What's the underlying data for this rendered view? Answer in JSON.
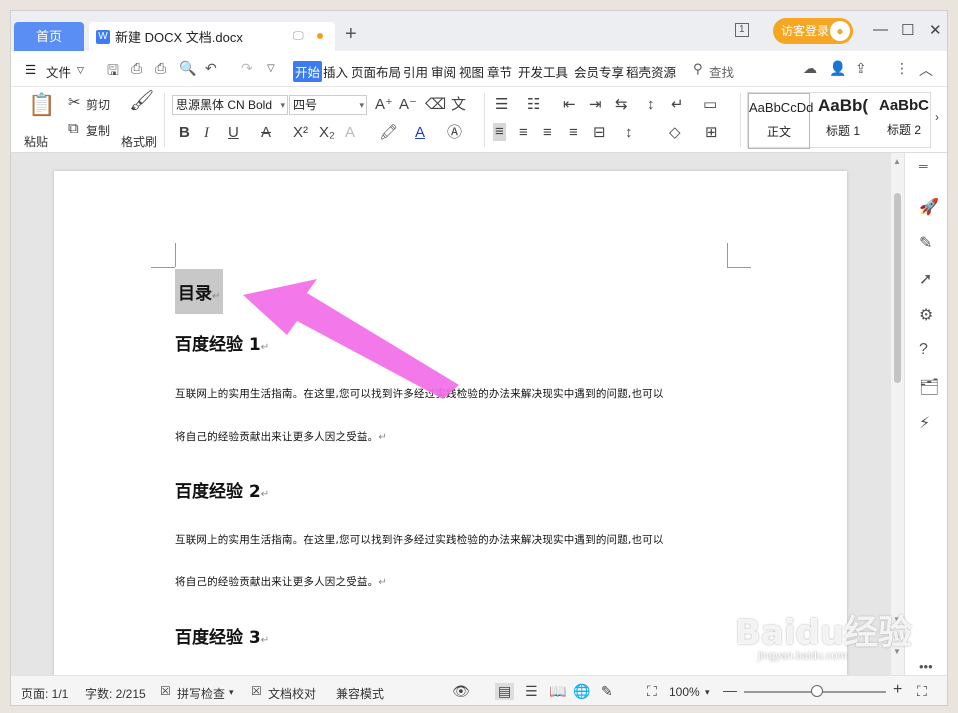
{
  "titlebar": {
    "home_tab": "首页",
    "doc_logo": "W",
    "doc_tab": "新建 DOCX 文档.docx",
    "login": "访客登录",
    "num_badge": "1"
  },
  "menu": {
    "file": "文件",
    "items": [
      "开始",
      "插入",
      "页面布局",
      "引用",
      "审阅",
      "视图",
      "章节",
      "开发工具",
      "会员专享",
      "稻壳资源"
    ],
    "search": "查找"
  },
  "ribbon": {
    "paste": "粘贴",
    "cut": "剪切",
    "copy": "复制",
    "format_painter": "格式刷",
    "font_name": "思源黑体 CN Bold",
    "font_size": "四号",
    "styles": [
      {
        "sample": "AaBbCcDd",
        "label": "正文"
      },
      {
        "sample": "AaBb(",
        "label": "标题 1"
      },
      {
        "sample": "AaBbC",
        "label": "标题 2"
      }
    ]
  },
  "document": {
    "toc_heading": "目录",
    "sections": [
      {
        "heading": "百度经验  1",
        "line1": "互联网上的实用生活指南。在这里,您可以找到许多经过实践检验的办法来解决现实中遇到的问题,也可以",
        "line2": "将自己的经验贡献出来让更多人因之受益。"
      },
      {
        "heading": "百度经验  2",
        "line1": "互联网上的实用生活指南。在这里,您可以找到许多经过实践检验的办法来解决现实中遇到的问题,也可以",
        "line2": "将自己的经验贡献出来让更多人因之受益。"
      },
      {
        "heading": "百度经验  3"
      }
    ],
    "para_mark": "↵"
  },
  "status": {
    "page": "页面: 1/1",
    "words": "字数: 2/215",
    "spell": "拼写检查",
    "proof": "文档校对",
    "compat": "兼容模式",
    "zoom": "100%"
  },
  "watermark": {
    "text": "Baidu经验",
    "url": "jingyan.baidu.com"
  },
  "colors": {
    "accent": "#3b7cf3",
    "login": "#f5a623",
    "arrow": "#f26ee8"
  }
}
